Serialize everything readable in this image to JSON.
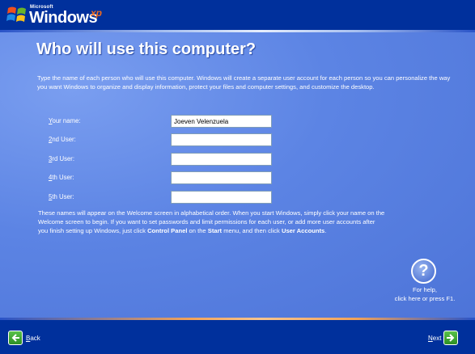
{
  "header": {
    "brand_small": "Microsoft",
    "brand_main": "Windows",
    "brand_suffix": "xp"
  },
  "page": {
    "title": "Who will use this computer?",
    "intro": "Type the name of each person who will use this computer. Windows will create a separate user account for each person so you can personalize the way you want Windows to organize and display information, protect your files and computer settings, and customize the desktop."
  },
  "fields": [
    {
      "accel": "Y",
      "label_rest": "our name:",
      "value": "Joeven Velenzuela"
    },
    {
      "accel": "2",
      "label_rest": "nd User:",
      "value": ""
    },
    {
      "accel": "3",
      "label_rest": "rd User:",
      "value": ""
    },
    {
      "accel": "4",
      "label_rest": "th User:",
      "value": ""
    },
    {
      "accel": "5",
      "label_rest": "th User:",
      "value": ""
    }
  ],
  "footer_note": {
    "part1": "These names will appear on the Welcome screen in alphabetical order. When you start Windows, simply click your name on the Welcome screen to begin. If you want to set passwords and limit permissions for each user, or add more user accounts after you finish setting up Windows, just click ",
    "bold1": "Control Panel",
    "part2": " on the ",
    "bold2": "Start",
    "part3": " menu, and then click ",
    "bold3": "User Accounts",
    "part4": "."
  },
  "help": {
    "glyph": "?",
    "line1": "For help,",
    "line2": "click here or press F1."
  },
  "nav": {
    "back_accel": "B",
    "back_rest": "ack",
    "next_accel": "N",
    "next_rest": "ext"
  },
  "icons": {
    "back": "back-arrow-icon",
    "next": "next-arrow-icon",
    "help": "help-icon",
    "flag": "windows-flag-icon"
  },
  "colors": {
    "top_bar": "#00309c",
    "main_bg": "#5a7edc",
    "xp_orange": "#f26b1d",
    "nav_green": "#3a9e2e"
  }
}
